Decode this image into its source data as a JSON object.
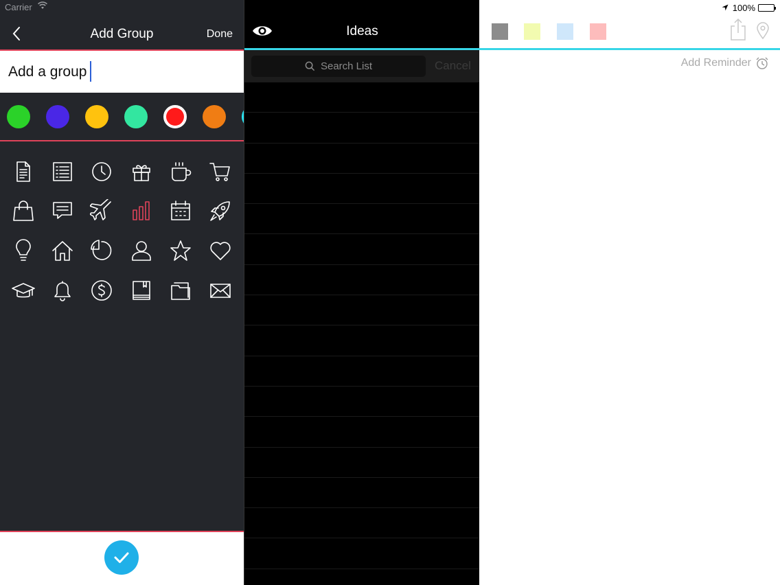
{
  "status_bar": {
    "carrier": "Carrier",
    "battery": "100%"
  },
  "left_panel": {
    "title": "Add Group",
    "done_label": "Done",
    "group_name_value": "Add a group",
    "colors": [
      "#2bd229",
      "#4a27e6",
      "#ffc20e",
      "#33e6a0",
      "#ff1a1a",
      "#f07d14",
      "#28e6f4",
      "#a72bee"
    ],
    "selected_color_index": 4,
    "icons": [
      [
        "document-icon",
        "list-icon",
        "clock-icon",
        "gift-icon",
        "coffee-cup-icon",
        "shopping-cart-icon"
      ],
      [
        "shopping-bag-icon",
        "chat-bubble-icon",
        "airplane-icon",
        "bar-chart-icon",
        "calendar-icon",
        "rocket-icon"
      ],
      [
        "lightbulb-icon",
        "home-icon",
        "pie-chart-icon",
        "user-icon",
        "star-icon",
        "heart-icon"
      ],
      [
        "graduation-cap-icon",
        "bell-icon",
        "dollar-coin-icon",
        "book-icon",
        "folder-icon",
        "envelope-icon"
      ]
    ],
    "selected_icon": "bar-chart-icon",
    "accent_color": "#e0435a",
    "confirm_color": "#1fb0e8"
  },
  "middle_panel": {
    "title": "Ideas",
    "search_placeholder": "Search List",
    "cancel_label": "Cancel",
    "row_count": 16
  },
  "right_panel": {
    "note_colors": [
      "#8c8c8c",
      "#f2fbb0",
      "#cfe7fb",
      "#fdbcbc"
    ],
    "add_reminder_label": "Add Reminder",
    "accent_color": "#37d6e7"
  }
}
